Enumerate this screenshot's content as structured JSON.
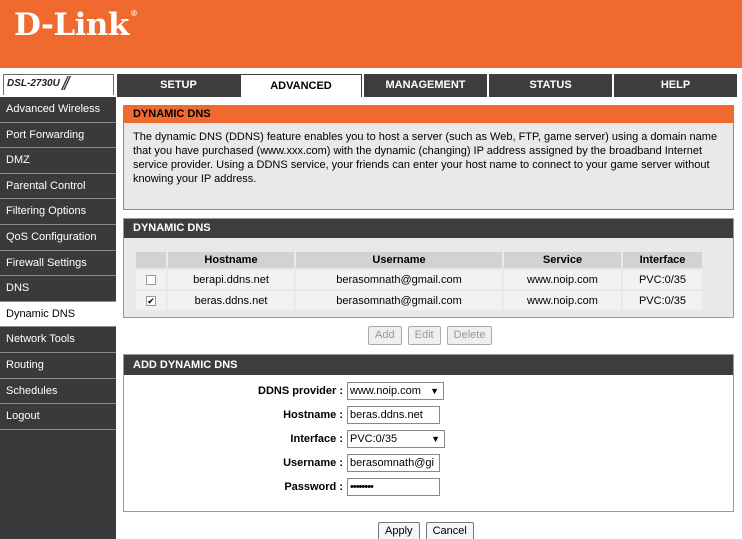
{
  "brand": {
    "logo_text": "D-Link",
    "tm": "®",
    "color": "#f0692e"
  },
  "model": {
    "name": "DSL-2730U",
    "slash": "//"
  },
  "tabs": [
    {
      "label": "SETUP",
      "active": false
    },
    {
      "label": "ADVANCED",
      "active": true
    },
    {
      "label": "MANAGEMENT",
      "active": false
    },
    {
      "label": "STATUS",
      "active": false
    },
    {
      "label": "HELP",
      "active": false
    }
  ],
  "sidebar": {
    "items": [
      {
        "label": "Advanced Wireless",
        "active": false
      },
      {
        "label": "Port Forwarding",
        "active": false
      },
      {
        "label": "DMZ",
        "active": false
      },
      {
        "label": "Parental Control",
        "active": false
      },
      {
        "label": "Filtering Options",
        "active": false
      },
      {
        "label": "QoS Configuration",
        "active": false
      },
      {
        "label": "Firewall Settings",
        "active": false
      },
      {
        "label": "DNS",
        "active": false
      },
      {
        "label": "Dynamic DNS",
        "active": true
      },
      {
        "label": "Network Tools",
        "active": false
      },
      {
        "label": "Routing",
        "active": false
      },
      {
        "label": "Schedules",
        "active": false
      },
      {
        "label": "Logout",
        "active": false
      }
    ]
  },
  "intro": {
    "title": "DYNAMIC DNS",
    "text": "The dynamic DNS (DDNS) feature enables you to host a server (such as Web, FTP, game server) using a domain name that you have purchased (www.xxx.com) with the dynamic (changing) IP address assigned by the broadband Internet service provider. Using a DDNS service, your friends can enter your host name to connect to your game server without knowing your IP address."
  },
  "ddns_list": {
    "title": "DYNAMIC DNS",
    "columns": [
      "",
      "Hostname",
      "Username",
      "Service",
      "Interface"
    ],
    "rows": [
      {
        "checked": false,
        "hostname": "berapi.ddns.net",
        "username": "berasomnath@gmail.com",
        "service": "www.noip.com",
        "interface": "PVC:0/35"
      },
      {
        "checked": true,
        "hostname": "beras.ddns.net",
        "username": "berasomnath@gmail.com",
        "service": "www.noip.com",
        "interface": "PVC:0/35"
      }
    ],
    "buttons": {
      "add": "Add",
      "edit": "Edit",
      "delete": "Delete"
    }
  },
  "add_form": {
    "title": "ADD DYNAMIC DNS",
    "provider_label": "DDNS provider :",
    "provider_value": "www.noip.com",
    "hostname_label": "Hostname :",
    "hostname_value": "beras.ddns.net",
    "interface_label": "Interface :",
    "interface_value": "PVC:0/35",
    "username_label": "Username :",
    "username_value": "berasomnath@gi",
    "password_label": "Password :",
    "password_value": "••••••••",
    "buttons": {
      "apply": "Apply",
      "cancel": "Cancel"
    }
  }
}
